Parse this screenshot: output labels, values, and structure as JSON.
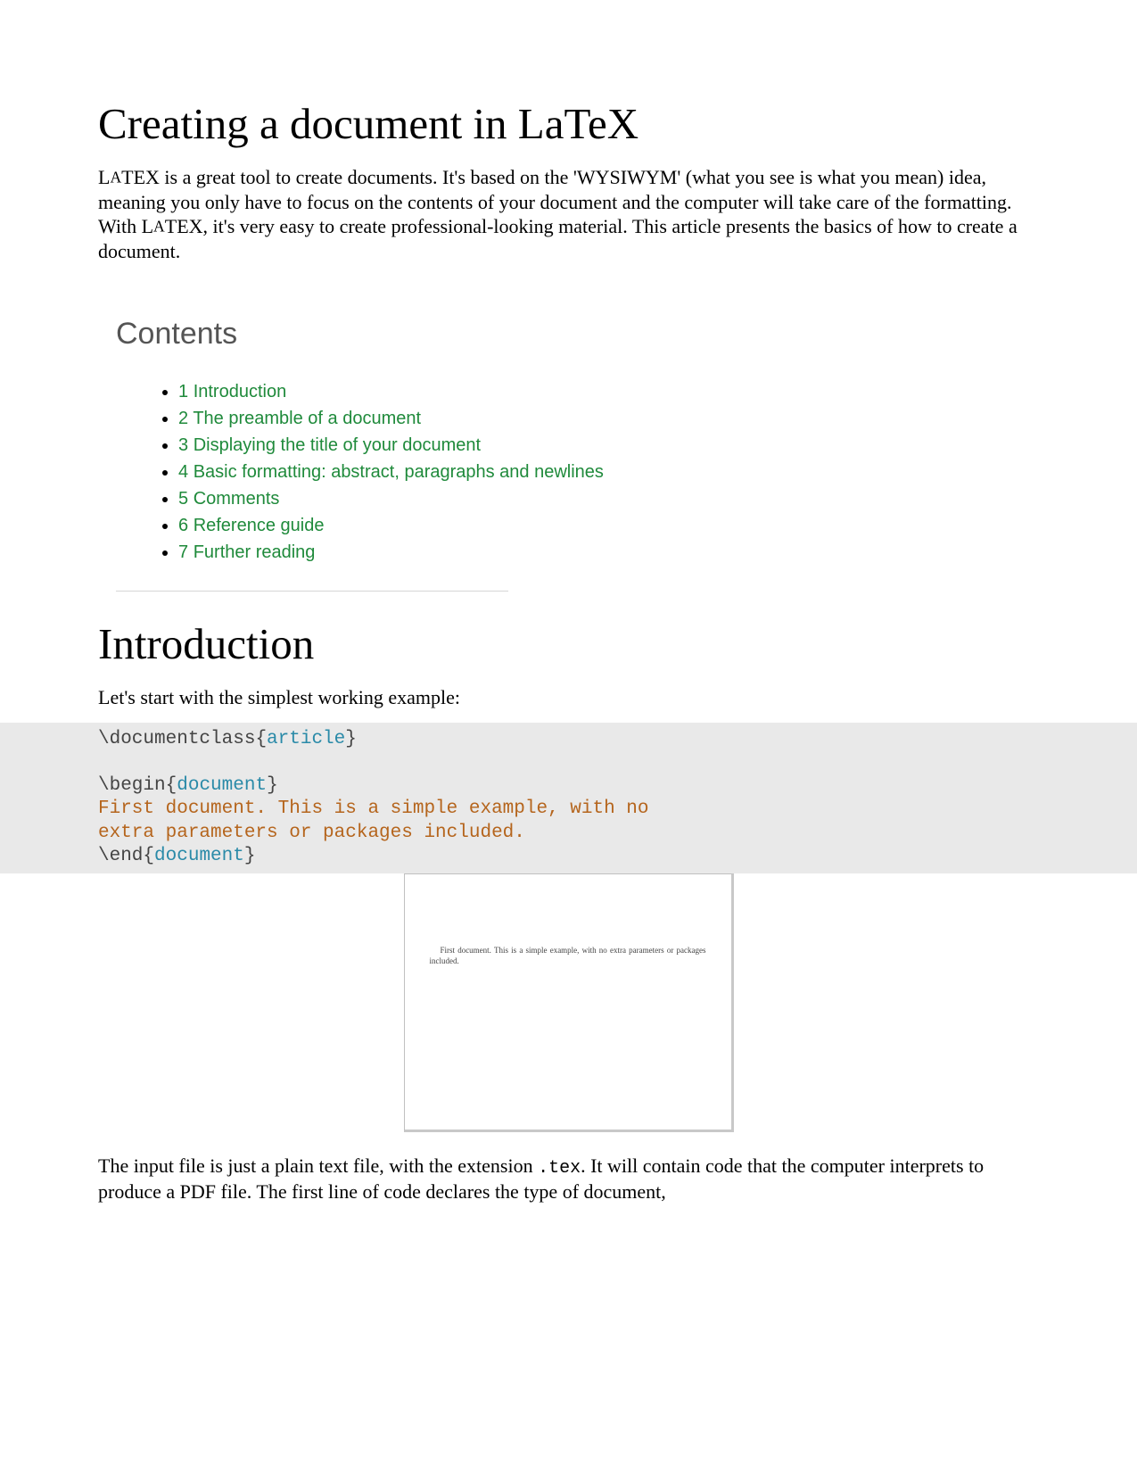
{
  "title": "Creating a document in LaTeX",
  "intro_parts": {
    "p1": "L",
    "p2": "A",
    "p3": "TEX is a great tool to create documents. It's based on the 'WYSIWYM' (what you see is what you mean) idea, meaning you only have to focus on the contents of your document and the computer will take care of the formatting. With L",
    "p4": "A",
    "p5": "TEX, it's very easy to create professional-looking material. This article presents the basics of how to create a document."
  },
  "contents_heading": "Contents",
  "toc": [
    {
      "num": "1",
      "label": "Introduction"
    },
    {
      "num": "2",
      "label": "The preamble of a document"
    },
    {
      "num": "3",
      "label": "Displaying the title of your document"
    },
    {
      "num": "4",
      "label": "Basic formatting: abstract, paragraphs and newlines"
    },
    {
      "num": "5",
      "label": "Comments"
    },
    {
      "num": "6",
      "label": "Reference guide"
    },
    {
      "num": "7",
      "label": "Further reading"
    }
  ],
  "section1_title": "Introduction",
  "section1_lead": "Let's start with the simplest working example:",
  "code": {
    "l1_cmd": "\\documentclass",
    "l1_open": "{",
    "l1_arg": "article",
    "l1_close": "}",
    "blank": "",
    "l3_cmd": "\\begin",
    "l3_open": "{",
    "l3_arg": "document",
    "l3_close": "}",
    "l4": "First document. This is a simple example, with no ",
    "l5": "extra parameters or packages included.",
    "l6_cmd": "\\end",
    "l6_open": "{",
    "l6_arg": "document",
    "l6_close": "}"
  },
  "preview_text": "First document.  This is a simple example, with no extra parameters or packages included.",
  "para2_a": "The input file is just a plain text file, with the extension ",
  "para2_code": ".tex",
  "para2_b": ". It will contain code that the computer interprets to produce a PDF file. The first line of code declares the type of document,"
}
